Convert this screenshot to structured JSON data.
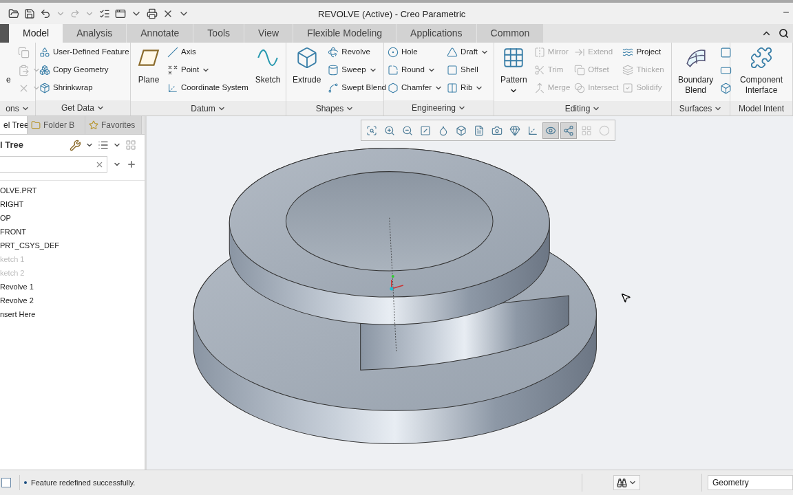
{
  "window": {
    "title": "REVOLVE (Active) - Creo Parametric"
  },
  "ribbon_tabs": [
    {
      "label": "Model",
      "selected": true
    },
    {
      "label": "Analysis",
      "selected": false
    },
    {
      "label": "Annotate",
      "selected": false
    },
    {
      "label": "Tools",
      "selected": false
    },
    {
      "label": "View",
      "selected": false
    },
    {
      "label": "Flexible Modeling",
      "selected": false
    },
    {
      "label": "Applications",
      "selected": false
    },
    {
      "label": "Common",
      "selected": false
    }
  ],
  "ribbon_groups": [
    {
      "label": "ons",
      "dropdown": true,
      "columns": [
        [
          {
            "kind": "large",
            "label": "e",
            "disabled": false,
            "dropdown": false
          }
        ],
        [
          {
            "kind": "icon",
            "disabled": true,
            "dropdown": false
          },
          {
            "kind": "icon",
            "disabled": true,
            "dropdown": true
          },
          {
            "kind": "icon",
            "disabled": true,
            "dropdown": true
          }
        ]
      ]
    },
    {
      "label": "Get Data",
      "dropdown": true,
      "columns": [
        [
          {
            "kind": "small",
            "label": "User-Defined Feature",
            "disabled": false,
            "dropdown": false
          },
          {
            "kind": "small",
            "label": "Copy Geometry",
            "disabled": false,
            "dropdown": false
          },
          {
            "kind": "small",
            "label": "Shrinkwrap",
            "disabled": false,
            "dropdown": false
          }
        ]
      ]
    },
    {
      "label": "Datum",
      "dropdown": true,
      "columns": [
        [
          {
            "kind": "large",
            "label": "Plane",
            "disabled": false,
            "dropdown": false
          }
        ],
        [
          {
            "kind": "small",
            "label": "Axis",
            "disabled": false,
            "dropdown": false
          },
          {
            "kind": "small",
            "label": "Point",
            "disabled": false,
            "dropdown": true
          },
          {
            "kind": "small",
            "label": "Coordinate System",
            "disabled": false,
            "dropdown": false
          }
        ],
        [
          {
            "kind": "large",
            "label": "Sketch",
            "disabled": false,
            "dropdown": false
          }
        ]
      ]
    },
    {
      "label": "Shapes",
      "dropdown": true,
      "columns": [
        [
          {
            "kind": "large",
            "label": "Extrude",
            "disabled": false,
            "dropdown": false
          }
        ],
        [
          {
            "kind": "small",
            "label": "Revolve",
            "disabled": false,
            "dropdown": false
          },
          {
            "kind": "small",
            "label": "Sweep",
            "disabled": false,
            "dropdown": true
          },
          {
            "kind": "small",
            "label": "Swept Blend",
            "disabled": false,
            "dropdown": false
          }
        ]
      ]
    },
    {
      "label": "Engineering",
      "dropdown": true,
      "columns": [
        [
          {
            "kind": "small",
            "label": "Hole",
            "disabled": false,
            "dropdown": false
          },
          {
            "kind": "small",
            "label": "Round",
            "disabled": false,
            "dropdown": true
          },
          {
            "kind": "small",
            "label": "Chamfer",
            "disabled": false,
            "dropdown": true
          }
        ],
        [
          {
            "kind": "small",
            "label": "Draft",
            "disabled": false,
            "dropdown": true
          },
          {
            "kind": "small",
            "label": "Shell",
            "disabled": false,
            "dropdown": false
          },
          {
            "kind": "small",
            "label": "Rib",
            "disabled": false,
            "dropdown": true
          }
        ]
      ]
    },
    {
      "label": "Editing",
      "dropdown": true,
      "columns": [
        [
          {
            "kind": "large",
            "label": "Pattern",
            "disabled": false,
            "dropdown": true
          }
        ],
        [
          {
            "kind": "small",
            "label": "Mirror",
            "disabled": true,
            "dropdown": false
          },
          {
            "kind": "small",
            "label": "Trim",
            "disabled": true,
            "dropdown": false
          },
          {
            "kind": "small",
            "label": "Merge",
            "disabled": true,
            "dropdown": false
          }
        ],
        [
          {
            "kind": "small",
            "label": "Extend",
            "disabled": true,
            "dropdown": false
          },
          {
            "kind": "small",
            "label": "Offset",
            "disabled": true,
            "dropdown": false
          },
          {
            "kind": "small",
            "label": "Intersect",
            "disabled": true,
            "dropdown": false
          }
        ],
        [
          {
            "kind": "small",
            "label": "Project",
            "disabled": false,
            "dropdown": false
          },
          {
            "kind": "small",
            "label": "Thicken",
            "disabled": true,
            "dropdown": false
          },
          {
            "kind": "small",
            "label": "Solidify",
            "disabled": true,
            "dropdown": false
          }
        ]
      ]
    },
    {
      "label": "Surfaces",
      "dropdown": true,
      "columns": [
        [
          {
            "kind": "large",
            "label": "Boundary Blend",
            "disabled": false,
            "dropdown": false
          }
        ],
        [
          {
            "kind": "icon",
            "disabled": false,
            "dropdown": false
          },
          {
            "kind": "icon",
            "disabled": false,
            "dropdown": false
          },
          {
            "kind": "icon",
            "disabled": false,
            "dropdown": false
          }
        ]
      ]
    },
    {
      "label": "Model Intent",
      "dropdown": false,
      "columns": [
        [
          {
            "kind": "large",
            "label": "Component Interface",
            "disabled": false,
            "dropdown": false
          }
        ]
      ]
    }
  ],
  "model_tree_panel": {
    "tabs": [
      {
        "label": "el Tree",
        "selected": true
      },
      {
        "label": "Folder B",
        "selected": false
      },
      {
        "label": "Favorites",
        "selected": false
      }
    ],
    "title": "l Tree",
    "items": [
      {
        "label": "OLVE.PRT",
        "dimmed": false
      },
      {
        "label": "RIGHT",
        "dimmed": false
      },
      {
        "label": "OP",
        "dimmed": false
      },
      {
        "label": "FRONT",
        "dimmed": false
      },
      {
        "label": "PRT_CSYS_DEF",
        "dimmed": false
      },
      {
        "label": "ketch 1",
        "dimmed": true
      },
      {
        "label": "ketch 2",
        "dimmed": true
      },
      {
        "label": "Revolve 1",
        "dimmed": false
      },
      {
        "label": "Revolve 2",
        "dimmed": false
      },
      {
        "label": "nsert Here",
        "dimmed": false
      }
    ]
  },
  "graphics_toolbar": [
    {
      "selected": false,
      "disabled": false
    },
    {
      "selected": false,
      "disabled": false
    },
    {
      "selected": false,
      "disabled": false
    },
    {
      "selected": false,
      "disabled": false
    },
    {
      "selected": false,
      "disabled": false
    },
    {
      "selected": false,
      "disabled": false
    },
    {
      "selected": false,
      "disabled": false
    },
    {
      "selected": false,
      "disabled": false
    },
    {
      "selected": false,
      "disabled": false
    },
    {
      "selected": false,
      "disabled": false
    },
    {
      "selected": true,
      "disabled": false
    },
    {
      "selected": true,
      "disabled": false
    },
    {
      "selected": false,
      "disabled": true
    },
    {
      "selected": false,
      "disabled": true
    }
  ],
  "status_bar": {
    "message": "Feature redefined successfully.",
    "filter": "Geometry"
  }
}
